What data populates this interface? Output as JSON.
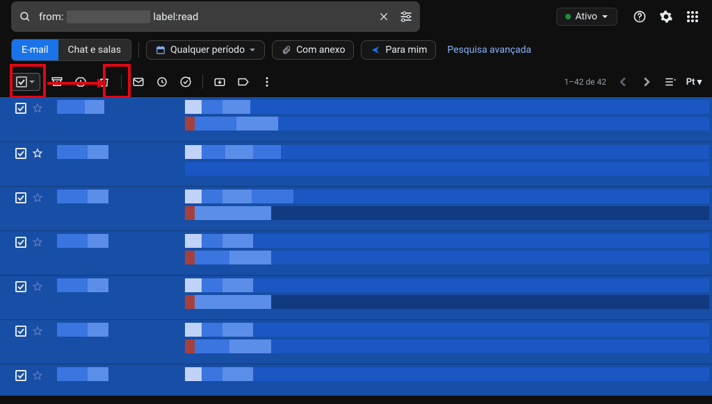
{
  "search": {
    "prefix": "from:",
    "redacted": "███████████",
    "suffix": "label:read"
  },
  "header": {
    "status_label": "Ativo"
  },
  "tabs": {
    "email": "E-mail",
    "chat": "Chat e salas"
  },
  "chips": {
    "any_time": "Qualquer período",
    "has_attachment": "Com anexo",
    "to_me": "Para mim",
    "advanced": "Pesquisa avançada"
  },
  "pager": {
    "range": "1–42 de 42"
  },
  "rows": 7
}
